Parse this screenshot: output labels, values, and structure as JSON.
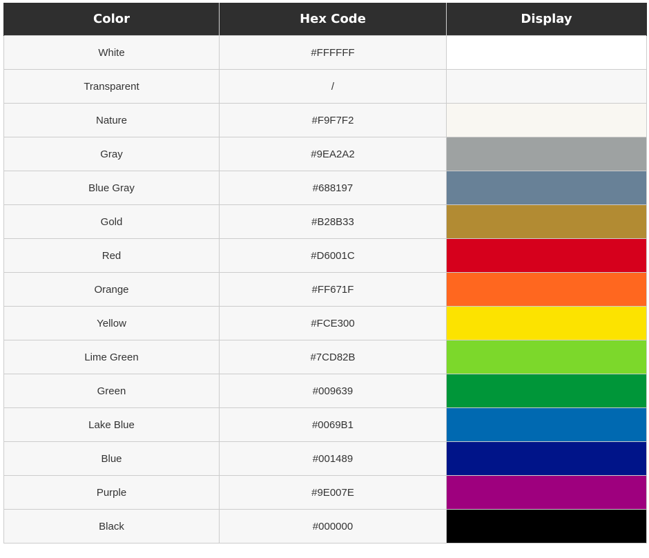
{
  "table": {
    "headers": [
      "Color",
      "Hex Code",
      "Display"
    ],
    "rows": [
      {
        "name": "White",
        "hex": "#FFFFFF",
        "display_color": "#FFFFFF"
      },
      {
        "name": "Transparent",
        "hex": "/",
        "display_color": "#F7F7F7"
      },
      {
        "name": "Nature",
        "hex": "#F9F7F2",
        "display_color": "#F9F7F2"
      },
      {
        "name": "Gray",
        "hex": "#9EA2A2",
        "display_color": "#9EA2A2"
      },
      {
        "name": "Blue Gray",
        "hex": "#688197",
        "display_color": "#688197"
      },
      {
        "name": "Gold",
        "hex": "#B28B33",
        "display_color": "#B28B33"
      },
      {
        "name": "Red",
        "hex": "#D6001C",
        "display_color": "#D6001C"
      },
      {
        "name": "Orange",
        "hex": "#FF671F",
        "display_color": "#FF671F"
      },
      {
        "name": "Yellow",
        "hex": "#FCE300",
        "display_color": "#FCE300"
      },
      {
        "name": "Lime Green",
        "hex": "#7CD82B",
        "display_color": "#7CD82B"
      },
      {
        "name": "Green",
        "hex": "#009639",
        "display_color": "#009639"
      },
      {
        "name": "Lake Blue",
        "hex": "#0069B1",
        "display_color": "#0069B1"
      },
      {
        "name": "Blue",
        "hex": "#001489",
        "display_color": "#001489"
      },
      {
        "name": "Purple",
        "hex": "#9E007E",
        "display_color": "#9E007E"
      },
      {
        "name": "Black",
        "hex": "#000000",
        "display_color": "#000000"
      }
    ]
  }
}
